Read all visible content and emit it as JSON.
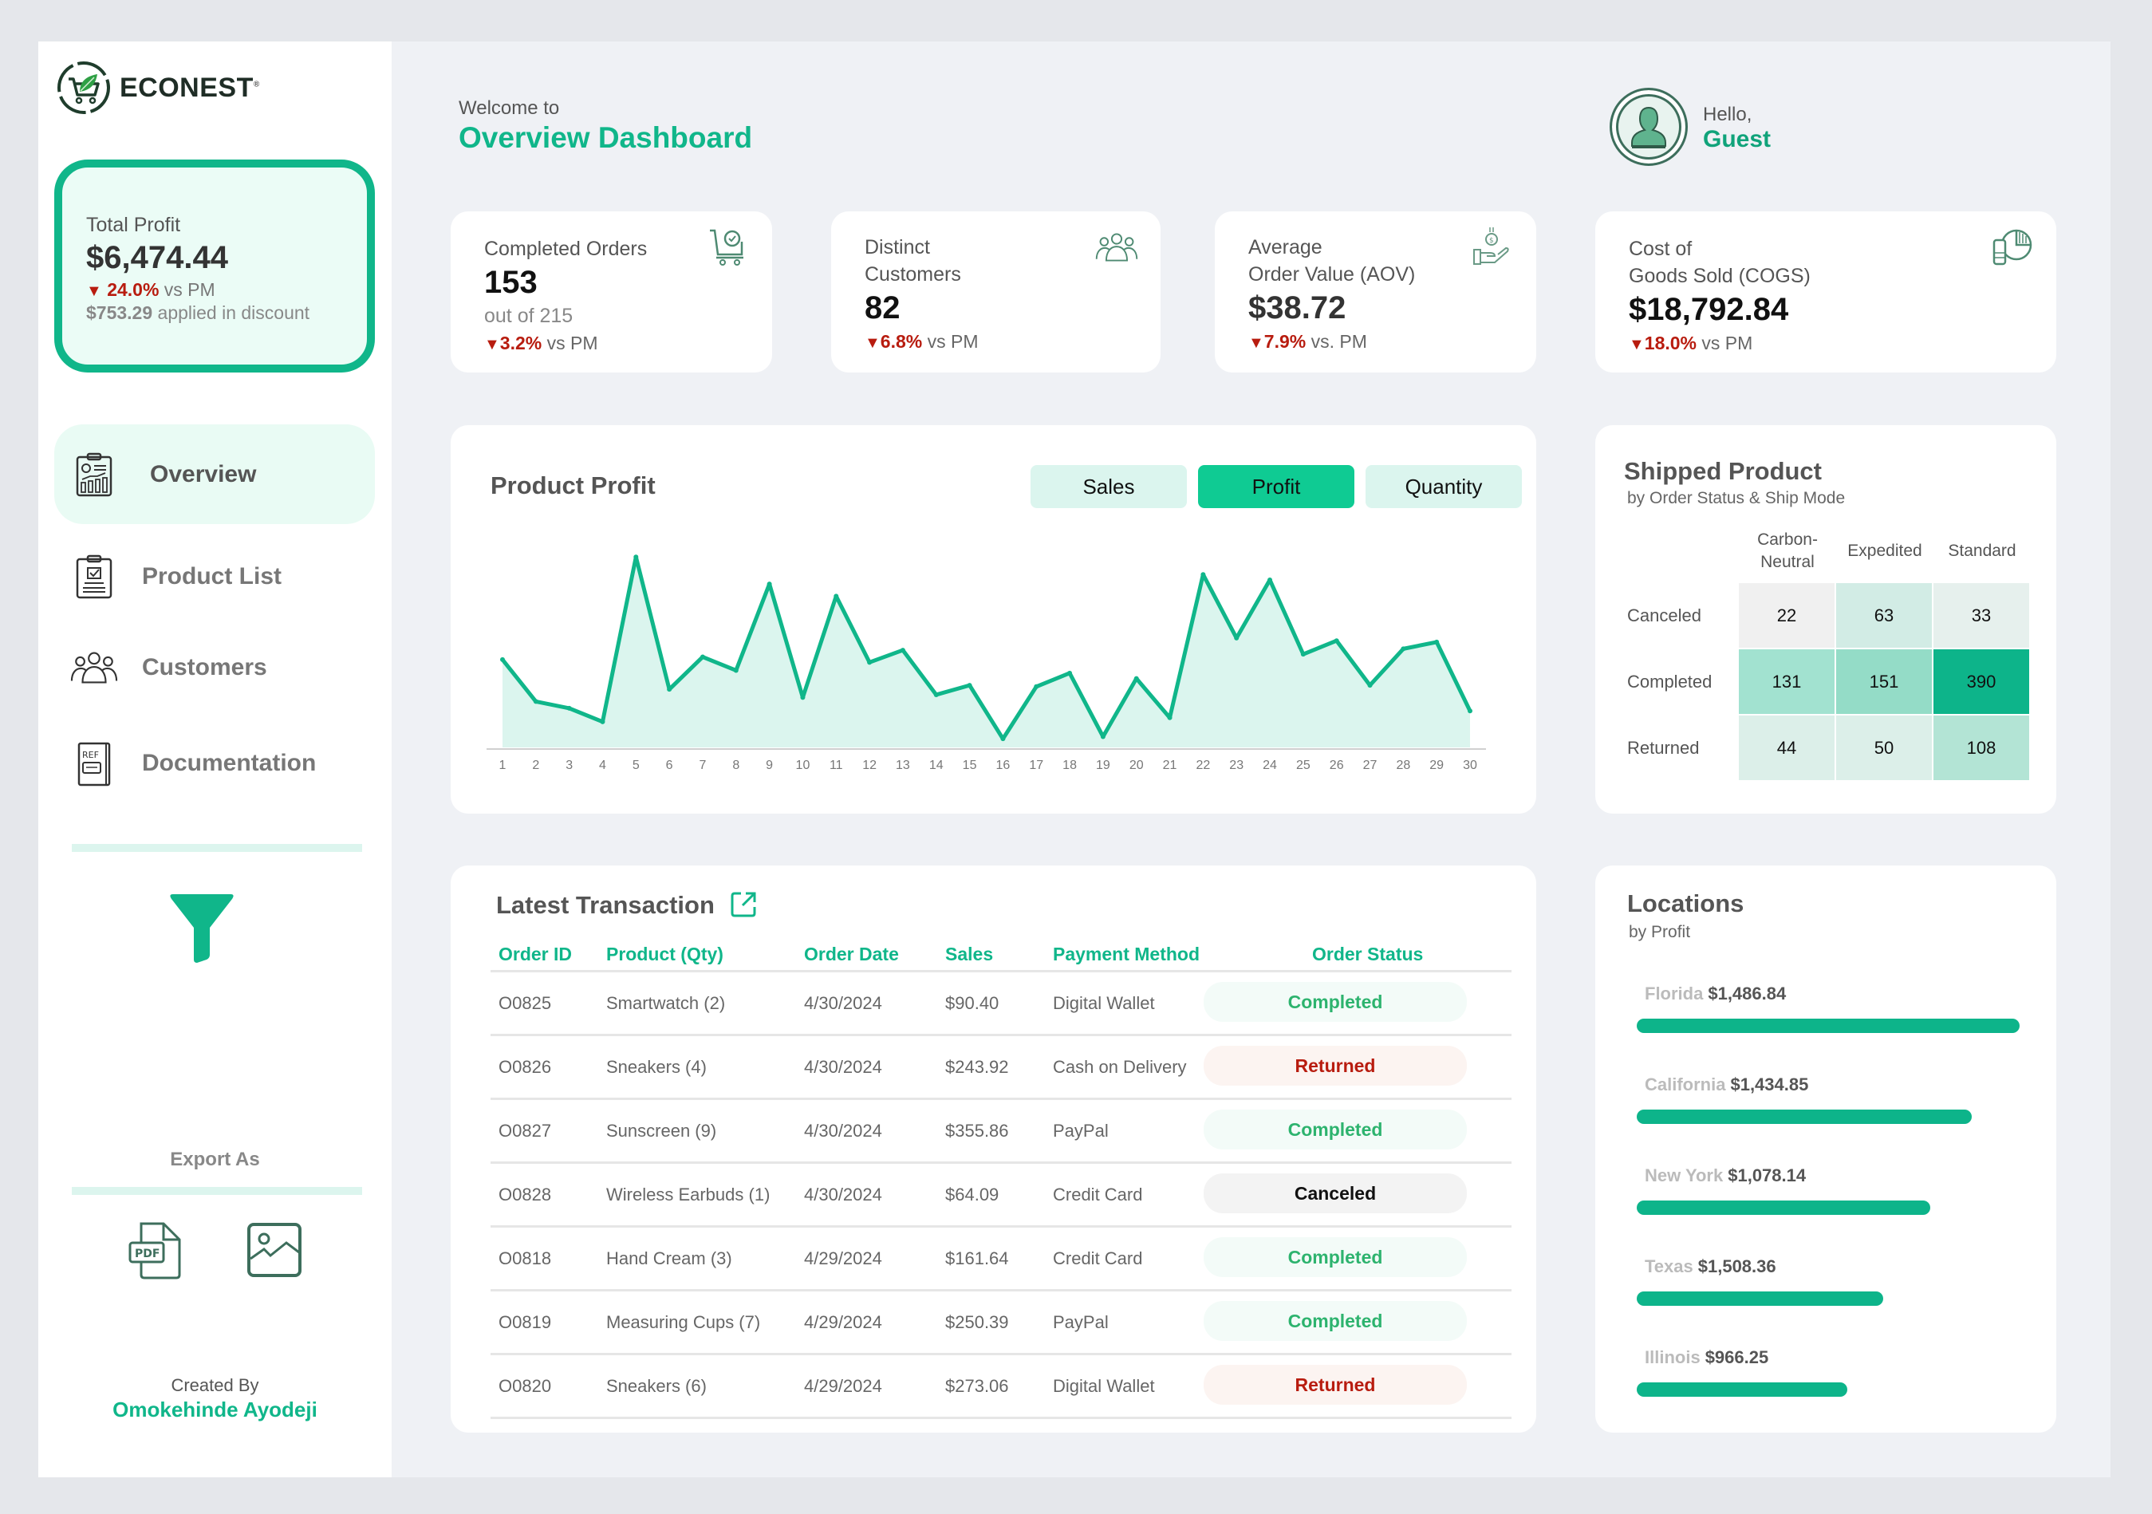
{
  "brand": {
    "name": "ECONEST",
    "mark": "®"
  },
  "total_profit": {
    "label": "Total Profit",
    "value": "$6,474.44",
    "change": "24.0%",
    "change_suffix": "vs PM",
    "discount_value": "$753.29",
    "discount_suffix": "applied in discount"
  },
  "nav": [
    {
      "label": "Overview",
      "icon": "report-clipboard-icon",
      "active": true
    },
    {
      "label": "Product List",
      "icon": "checklist-clipboard-icon",
      "active": false
    },
    {
      "label": "Customers",
      "icon": "users-group-icon",
      "active": false
    },
    {
      "label": "Documentation",
      "icon": "ref-document-icon",
      "active": false
    }
  ],
  "sidebar": {
    "filter_icon": "funnel-icon",
    "export_label": "Export As",
    "export_pdf": "PDF",
    "created_label": "Created By",
    "created_name": "Omokehinde Ayodeji"
  },
  "header": {
    "welcome": "Welcome to",
    "title": "Overview Dashboard",
    "hello": "Hello,",
    "user": "Guest"
  },
  "kpis": [
    {
      "label_lines": [
        "Completed Orders"
      ],
      "value": "153",
      "sub": "out of 215",
      "change": "3.2%",
      "suffix": "vs PM",
      "icon": "cart-check-icon"
    },
    {
      "label_lines": [
        "Distinct",
        "Customers"
      ],
      "value": "82",
      "sub": "",
      "change": "6.8%",
      "suffix": "vs PM",
      "icon": "users-group-icon"
    },
    {
      "label_lines": [
        "Average",
        "Order Value (AOV)"
      ],
      "value": "$38.72",
      "sub": "",
      "change": "7.9%",
      "suffix": "vs. PM",
      "icon": "hand-coin-icon"
    },
    {
      "label_lines": [
        "Cost of",
        "Goods Sold (COGS)"
      ],
      "value": "$18,792.84",
      "sub": "",
      "change": "18.0%",
      "suffix": "vs PM",
      "icon": "pie-coins-icon"
    }
  ],
  "colors": {
    "accent": "#10b68a",
    "accent_bright": "#0fcb93",
    "negative": "#b81c0f",
    "area_fill": "#dbf5ee"
  },
  "product_chart": {
    "title": "Product Profit",
    "toggles": [
      {
        "label": "Sales",
        "active": false
      },
      {
        "label": "Profit",
        "active": true
      },
      {
        "label": "Quantity",
        "active": false
      }
    ]
  },
  "chart_data": [
    {
      "type": "area",
      "title": "Product Profit",
      "xlabel": "",
      "ylabel": "",
      "x": [
        1,
        2,
        3,
        4,
        5,
        6,
        7,
        8,
        9,
        10,
        11,
        12,
        13,
        14,
        15,
        16,
        17,
        18,
        19,
        20,
        21,
        22,
        23,
        24,
        25,
        26,
        27,
        28,
        29,
        30
      ],
      "values": [
        325,
        170,
        145,
        95,
        705,
        215,
        335,
        285,
        605,
        185,
        560,
        315,
        360,
        195,
        230,
        32,
        225,
        275,
        40,
        255,
        110,
        640,
        405,
        620,
        345,
        395,
        230,
        365,
        390,
        135
      ],
      "value_note": "relative units; no y-axis shown",
      "ylim": [
        0,
        750
      ],
      "grid": false,
      "legend": "none"
    },
    {
      "type": "heatmap",
      "title": "Shipped Product",
      "subtitle": "by Order Status & Ship Mode",
      "columns": [
        "Carbon-Neutral",
        "Expedited",
        "Standard"
      ],
      "rows": [
        "Canceled",
        "Completed",
        "Returned"
      ],
      "values": [
        [
          22,
          63,
          33
        ],
        [
          131,
          151,
          390
        ],
        [
          44,
          50,
          108
        ]
      ]
    },
    {
      "type": "bar",
      "orientation": "horizontal",
      "title": "Locations",
      "subtitle": "by Profit",
      "categories": [
        "Florida",
        "California",
        "New York",
        "Texas",
        "Illinois"
      ],
      "labels": [
        "$1,486.84",
        "$1,434.85",
        "$1,078.14",
        "$1,508.36",
        "$966.25"
      ],
      "bar_fraction": [
        1.0,
        0.876,
        0.767,
        0.643,
        0.551
      ]
    }
  ],
  "heatmap_colors": [
    [
      "#f0f0f0",
      "#d2ece5",
      "#e6f0ed"
    ],
    [
      "#a2e2d0",
      "#94dcc7",
      "#0db48a"
    ],
    [
      "#dcefe9",
      "#dcefe9",
      "#b3e4d5"
    ]
  ],
  "transactions": {
    "title": "Latest Transaction",
    "columns": [
      "Order ID",
      "Product (Qty)",
      "Order Date",
      "Sales",
      "Payment Method",
      "Order Status"
    ],
    "rows": [
      {
        "id": "O0825",
        "product": "Smartwatch (2)",
        "date": "4/30/2024",
        "sales": "$90.40",
        "payment": "Digital Wallet",
        "status": "Completed"
      },
      {
        "id": "O0826",
        "product": "Sneakers (4)",
        "date": "4/30/2024",
        "sales": "$243.92",
        "payment": "Cash on Delivery",
        "status": "Returned"
      },
      {
        "id": "O0827",
        "product": "Sunscreen (9)",
        "date": "4/30/2024",
        "sales": "$355.86",
        "payment": "PayPal",
        "status": "Completed"
      },
      {
        "id": "O0828",
        "product": "Wireless Earbuds (1)",
        "date": "4/30/2024",
        "sales": "$64.09",
        "payment": "Credit Card",
        "status": "Canceled"
      },
      {
        "id": "O0818",
        "product": "Hand Cream (3)",
        "date": "4/29/2024",
        "sales": "$161.64",
        "payment": "Credit Card",
        "status": "Completed"
      },
      {
        "id": "O0819",
        "product": "Measuring Cups (7)",
        "date": "4/29/2024",
        "sales": "$250.39",
        "payment": "PayPal",
        "status": "Completed"
      },
      {
        "id": "O0820",
        "product": "Sneakers (6)",
        "date": "4/29/2024",
        "sales": "$273.06",
        "payment": "Digital Wallet",
        "status": "Returned"
      }
    ]
  },
  "locations": {
    "title": "Locations",
    "subtitle": "by Profit"
  },
  "heatmap_panel": {
    "title": "Shipped Product",
    "subtitle": "by Order Status & Ship Mode",
    "col_lines": [
      [
        "Carbon-",
        "Neutral"
      ],
      [
        "Expedited"
      ],
      [
        "Standard"
      ]
    ]
  }
}
